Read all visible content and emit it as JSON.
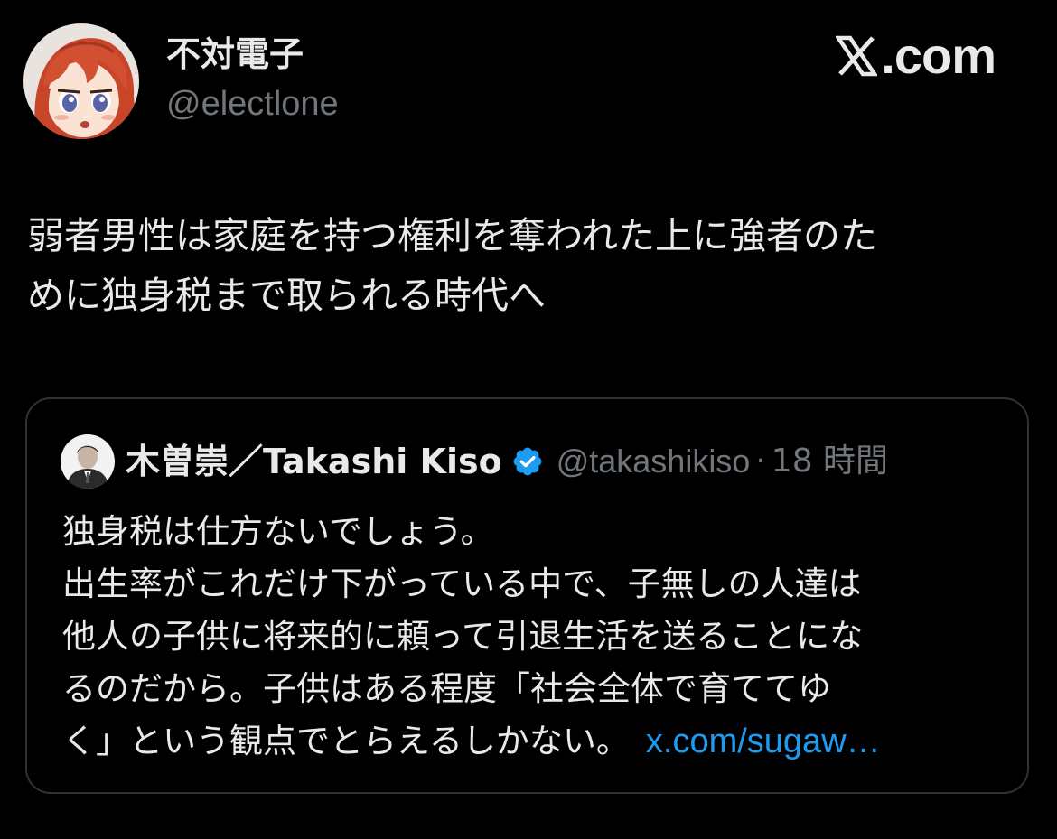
{
  "author": {
    "name": "不対電子",
    "handle": "@electlone",
    "avatar_icon": "anime-girl-avatar"
  },
  "site": {
    "logo_icon": "x-logo-icon",
    "name": ".com"
  },
  "tweet": {
    "lines": [
      "弱者男性は家庭を持つ権利を奪われた上に強者のた",
      "めに独身税まで取られる時代へ"
    ]
  },
  "quote": {
    "avatar_icon": "man-in-suit-avatar",
    "name": "木曽崇／Takashi Kiso",
    "verified_icon": "verified-badge-icon",
    "handle": "@takashikiso",
    "separator": "·",
    "time": "18 時間",
    "lines": [
      "独身税は仕方ないでしょう。",
      "出生率がこれだけ下がっている中で、子無しの人達は",
      "他人の子供に将来的に頼って引退生活を送ることにな",
      "るのだから。子供はある程度「社会全体で育ててゆ",
      "く」という観点でとらえるしかない。"
    ],
    "link": "x.com/sugaw…"
  },
  "colors": {
    "background": "#000000",
    "text_primary": "#e7e9ea",
    "text_secondary": "#71767b",
    "border": "#2f3336",
    "link": "#1d9bf0",
    "verified": "#1d9bf0"
  }
}
